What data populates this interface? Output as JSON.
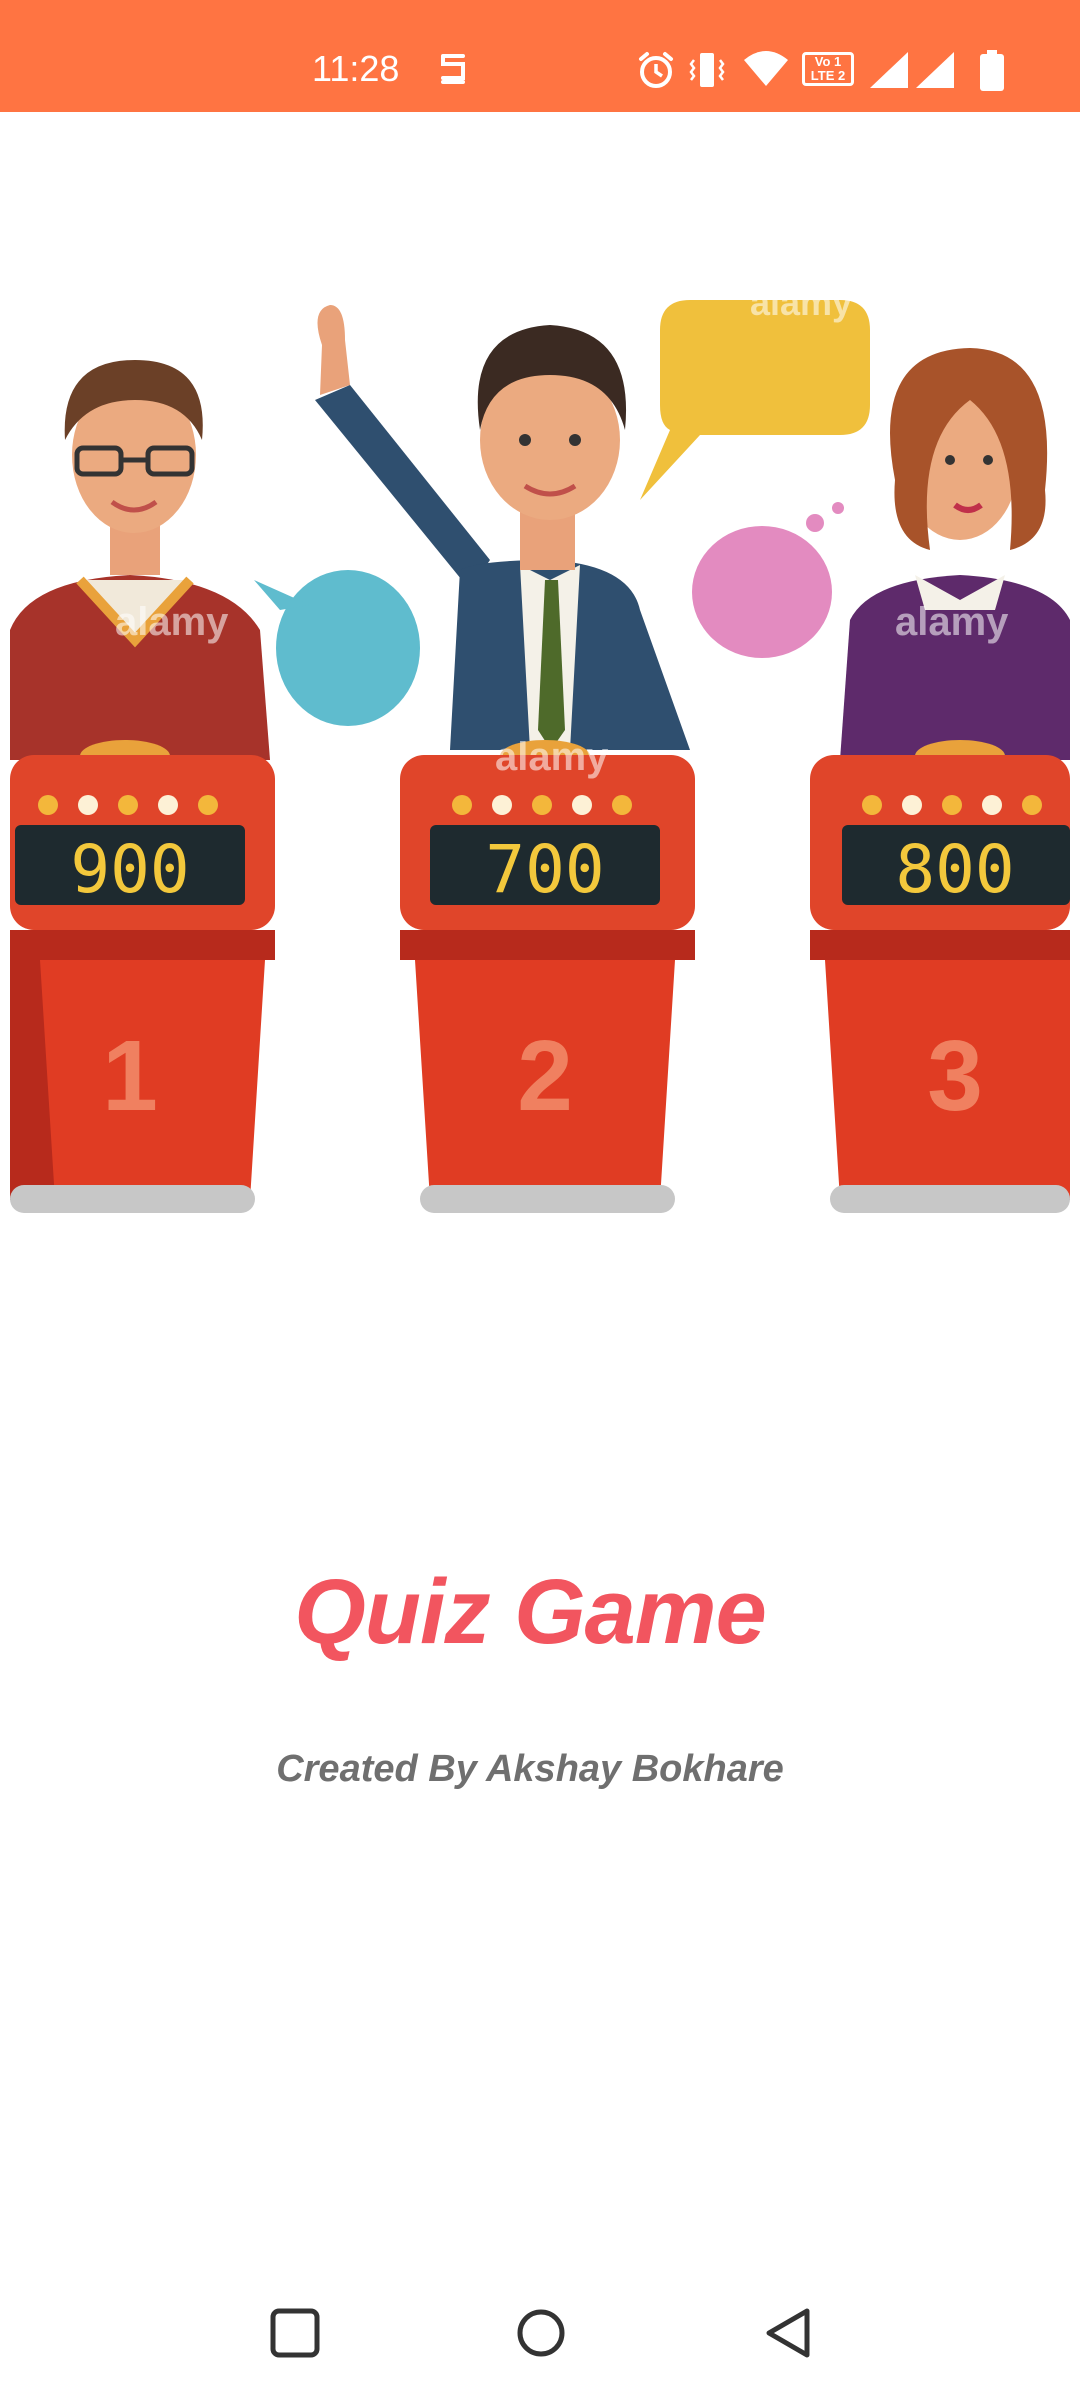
{
  "status_bar": {
    "time": "11:28",
    "icons": [
      "s-icon",
      "alarm-icon",
      "vibrate-icon",
      "wifi-icon",
      "volte-icon",
      "signal-icon",
      "signal-icon-2",
      "battery-icon"
    ],
    "volte_text": "Vo 1 LTE 2",
    "color": "#FF7442"
  },
  "illustration": {
    "watermark": "alamy",
    "contestants": [
      {
        "score": "900",
        "number": "1"
      },
      {
        "score": "700",
        "number": "2"
      },
      {
        "score": "800",
        "number": "3"
      }
    ]
  },
  "splash": {
    "title": "Quiz Game",
    "credit": "Created By Akshay Bokhare",
    "title_color": "#F2555F"
  },
  "nav_bar": {
    "buttons": [
      "recents-icon",
      "home-icon",
      "back-icon"
    ]
  }
}
